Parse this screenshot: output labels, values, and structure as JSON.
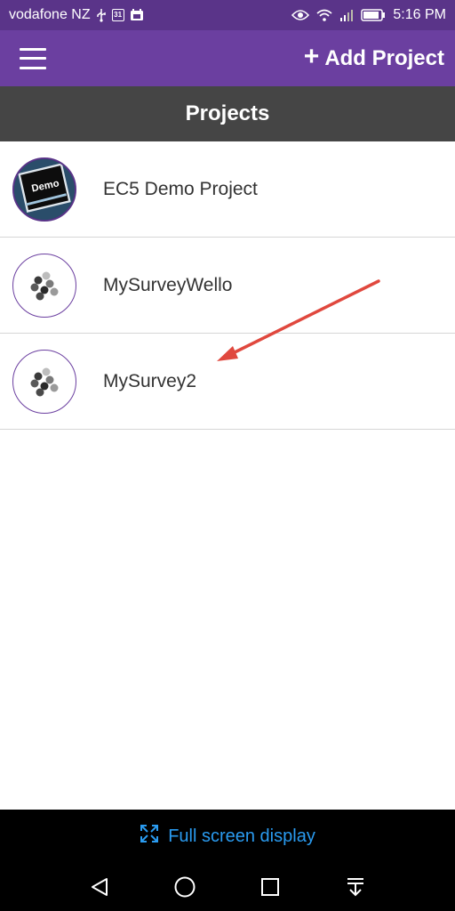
{
  "status_bar": {
    "carrier": "vodafone NZ",
    "calendar_day": "31",
    "time": "5:16 PM",
    "icons": [
      "usb-icon",
      "calendar-icon",
      "gallery-icon",
      "eye-icon",
      "wifi-icon",
      "signal-icon",
      "battery-icon"
    ]
  },
  "app_bar": {
    "menu_icon": "hamburger-menu-icon",
    "add_project_label": "Add Project",
    "add_icon": "plus-icon",
    "color": "#6b3fa0"
  },
  "header": {
    "title": "Projects"
  },
  "projects": [
    {
      "name": "EC5 Demo Project",
      "avatar": "demo-keyboard-key",
      "avatar_text": "Demo"
    },
    {
      "name": "MySurveyWello",
      "avatar": "epicollect-dots-logo"
    },
    {
      "name": "MySurvey2",
      "avatar": "epicollect-dots-logo"
    }
  ],
  "annotation": {
    "type": "arrow",
    "color": "#e0483e",
    "points_to": "MySurvey2"
  },
  "bottom": {
    "full_screen_label": "Full screen display",
    "full_screen_icon": "expand-icon",
    "accent": "#2a9bf0"
  },
  "nav": [
    "back-icon",
    "home-icon",
    "recents-icon",
    "notification-pull-icon"
  ]
}
